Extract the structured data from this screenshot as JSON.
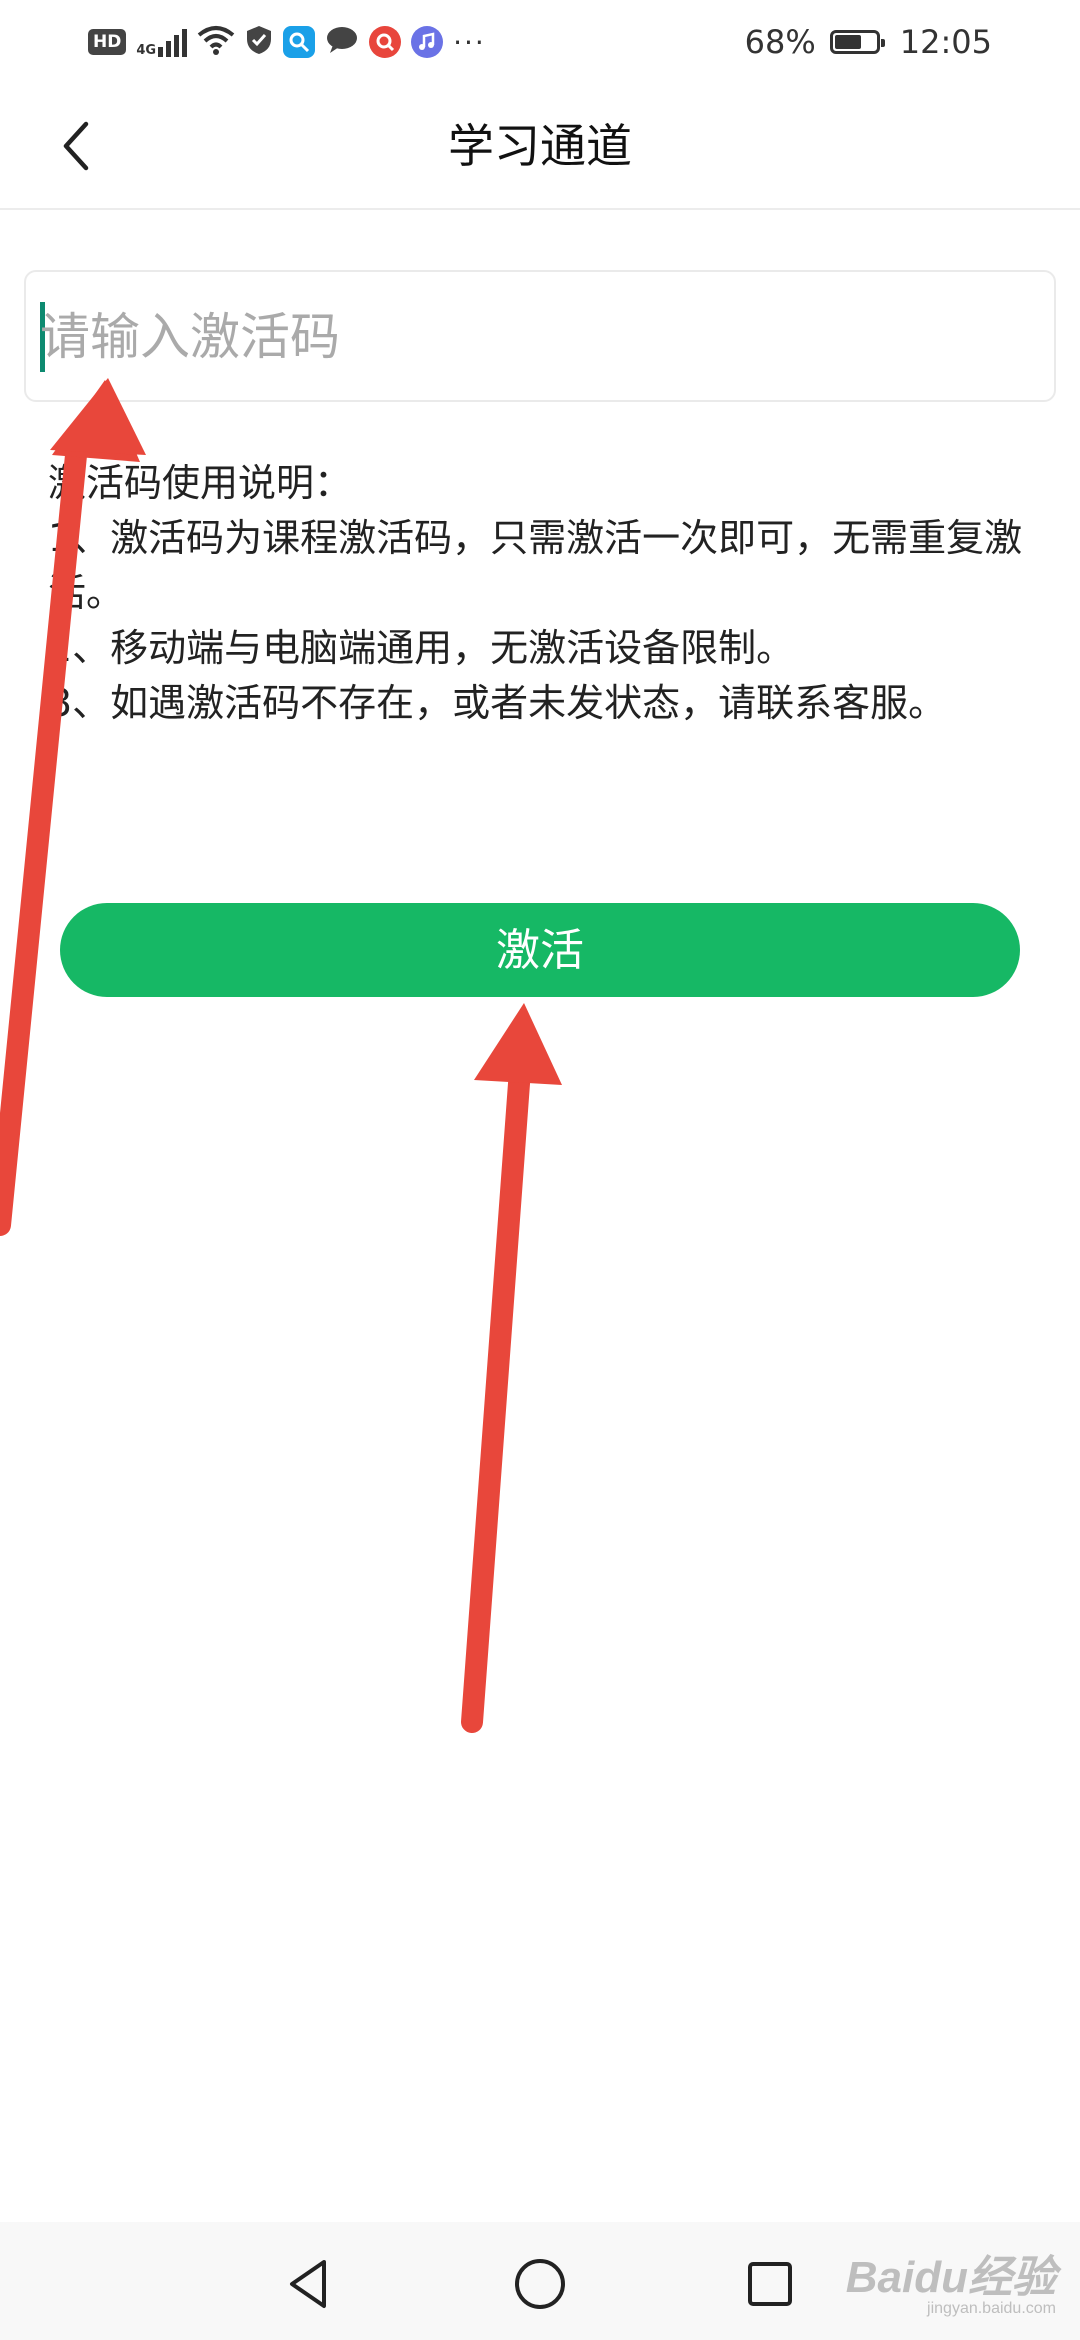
{
  "status_bar": {
    "hd_label": "HD",
    "network_label": "4G",
    "battery_percent": "68%",
    "battery_level": 0.68,
    "time": "12:05",
    "more_label": "···",
    "icons": [
      "hd-icon",
      "signal-icon",
      "wifi-icon",
      "shield-icon",
      "search-app-icon",
      "chat-icon",
      "red-app-icon",
      "music-app-icon",
      "more-icon",
      "battery-icon"
    ]
  },
  "header": {
    "title": "学习通道",
    "back_icon": "chevron-left-icon"
  },
  "activation_input": {
    "placeholder": "请输入激活码",
    "value": ""
  },
  "instructions": {
    "heading": "激活码使用说明：",
    "items": [
      "1、激活码为课程激活码，只需激活一次即可，无需重复激活。",
      "2、移动端与电脑端通用，无激活设备限制。",
      "3、如遇激活码不存在，或者未发状态，请联系客服。"
    ]
  },
  "activate_button": {
    "label": "激活",
    "color": "#16b865"
  },
  "annotation": {
    "arrow_color": "#e8473b"
  },
  "nav_bar": {
    "icons": [
      "back-triangle-icon",
      "home-circle-icon",
      "recents-square-icon"
    ]
  },
  "watermark": {
    "logo": "Baidu经验",
    "sub": "jingyan.baidu.com"
  }
}
